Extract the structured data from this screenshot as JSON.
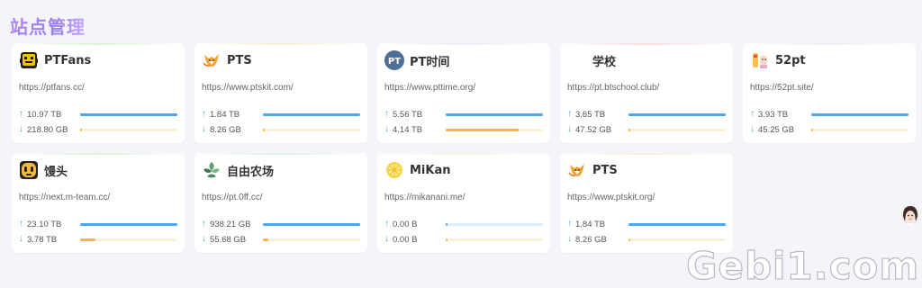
{
  "page": {
    "title": "站点管理"
  },
  "sites": [
    {
      "name": "PTFans",
      "url": "https://ptfans.cc/",
      "upload": "10.97 TB",
      "download": "218.80 GB",
      "upload_fill": 1.0,
      "download_fill": 0.02,
      "icon": "ptfans-robot-icon",
      "glow": "#d8f0d0"
    },
    {
      "name": "PTS",
      "url": "https://www.ptskit.com/",
      "upload": "1.84 TB",
      "download": "8.26 GB",
      "upload_fill": 1.0,
      "download_fill": 0.02,
      "icon": "pts-fox-icon",
      "glow": "#f8ecd0"
    },
    {
      "name": "PT时间",
      "url": "https://www.pttime.org/",
      "upload": "5.56 TB",
      "download": "4.14 TB",
      "upload_fill": 1.0,
      "download_fill": 0.75,
      "icon": "pttime-badge-icon",
      "glow": "#e6ecf6"
    },
    {
      "name": "学校",
      "url": "https://pt.btschool.club/",
      "upload": "3.65 TB",
      "download": "47.52 GB",
      "upload_fill": 1.0,
      "download_fill": 0.02,
      "icon": "school-icon",
      "glow": "#f8d8d8"
    },
    {
      "name": "52pt",
      "url": "https://52pt.site/",
      "upload": "3.93 TB",
      "download": "45.25 GB",
      "upload_fill": 1.0,
      "download_fill": 0.02,
      "icon": "52pt-character-icon",
      "glow": "#e8eef6"
    },
    {
      "name": "馒头",
      "url": "https://next.m-team.cc/",
      "upload": "23.10 TB",
      "download": "3.78 TB",
      "upload_fill": 1.0,
      "download_fill": 0.16,
      "icon": "mteam-face-icon",
      "glow": "#d8f0d0"
    },
    {
      "name": "自由农场",
      "url": "https://pt.0ff.cc/",
      "upload": "938.21 GB",
      "download": "55.68 GB",
      "upload_fill": 1.0,
      "download_fill": 0.06,
      "icon": "farm-leaves-icon",
      "glow": "#d8f0e0"
    },
    {
      "name": "MiKan",
      "url": "https://mikanani.me/",
      "upload": "0.00 B",
      "download": "0.00 B",
      "upload_fill": 0.02,
      "download_fill": 0.02,
      "icon": "mikan-lemon-icon",
      "glow": "#f6f2d8"
    },
    {
      "name": "PTS",
      "url": "https://www.ptskit.org/",
      "upload": "1.84 TB",
      "download": "8.26 GB",
      "upload_fill": 1.0,
      "download_fill": 0.02,
      "icon": "pts-fox-icon",
      "glow": "#f8ecd0"
    }
  ],
  "arrows": {
    "up": "↑",
    "down": "↓"
  },
  "watermark": "Gebi1.com"
}
